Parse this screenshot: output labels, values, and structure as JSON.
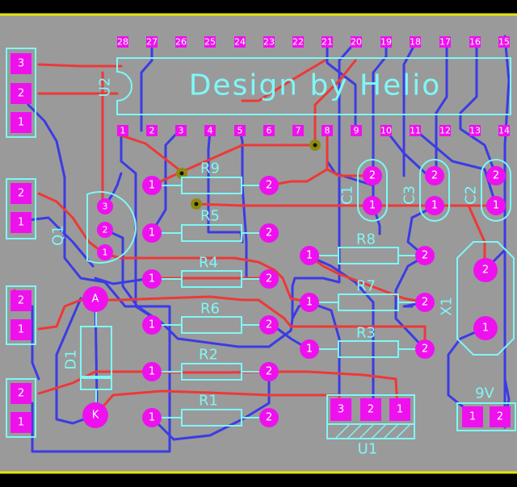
{
  "title_text": "Design by Helio",
  "u2": {
    "ref": "U2",
    "top_pins": [
      "28",
      "27",
      "26",
      "25",
      "24",
      "23",
      "22",
      "21",
      "20",
      "19",
      "18",
      "17",
      "16",
      "15"
    ],
    "bottom_pins": [
      "1",
      "2",
      "3",
      "4",
      "5",
      "6",
      "7",
      "8",
      "9",
      "10",
      "11",
      "12",
      "13",
      "14"
    ]
  },
  "resistors": {
    "r9": "R9",
    "r5": "R5",
    "r4": "R4",
    "r6": "R6",
    "r2": "R2",
    "r1": "R1",
    "r8": "R8",
    "r7": "R7",
    "r3": "R3"
  },
  "pad_labels": {
    "one": "1",
    "two": "2",
    "three": "3",
    "anode": "A",
    "cathode": "K"
  },
  "caps": {
    "c1": "C1",
    "c3": "C3",
    "c2": "C2"
  },
  "parts": {
    "q1": "Q1",
    "d1": "D1",
    "x1": "X1",
    "u1": "U1",
    "battery": "9V"
  },
  "connectors": {
    "j1": [
      "3",
      "2",
      "1"
    ],
    "j2": [
      "2",
      "1"
    ],
    "j3": [
      "2",
      "1"
    ],
    "j4": [
      "2",
      "1"
    ],
    "u1_pins": [
      "3",
      "2",
      "1"
    ],
    "batt_pins": [
      "1",
      "2"
    ]
  },
  "colors": {
    "background": "#9a9a9a",
    "frame": "#e5e500",
    "top_copper": "#ee3838",
    "bottom_copper": "#3b3be6",
    "silkscreen": "#7ff7f7",
    "pad": "#ee11ee",
    "via": "#8e8a0e"
  }
}
